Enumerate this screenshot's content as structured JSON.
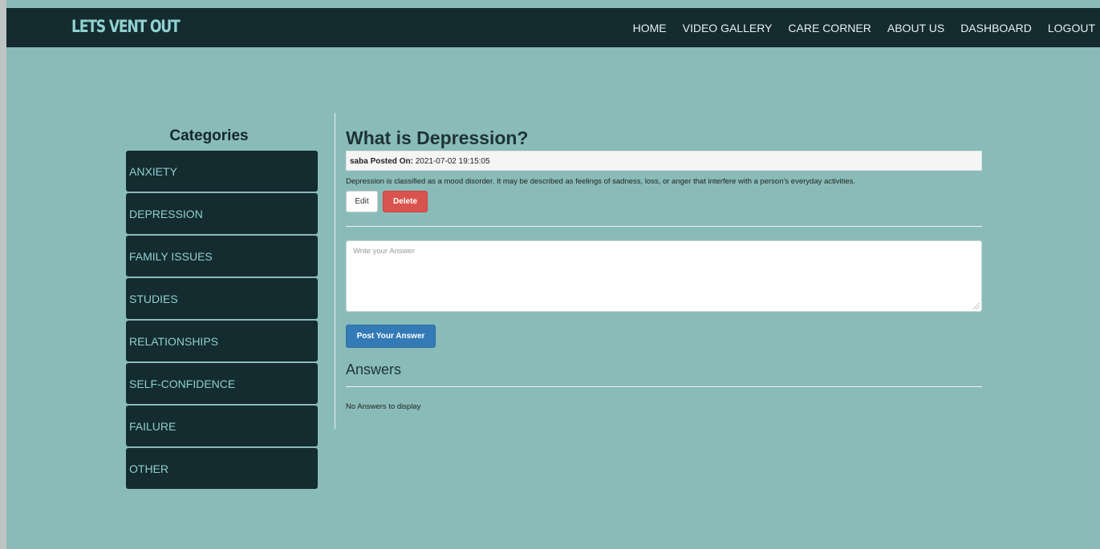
{
  "navbar": {
    "brand": "LETS VENT OUT",
    "links": [
      "HOME",
      "VIDEO GALLERY",
      "CARE CORNER",
      "ABOUT US",
      "DASHBOARD",
      "LOGOUT"
    ]
  },
  "sidebar": {
    "title": "Categories",
    "items": [
      "ANXIETY",
      "DEPRESSION",
      "FAMILY ISSUES",
      "STUDIES",
      "RELATIONSHIPS",
      "SELF-CONFIDENCE",
      "FAILURE",
      "OTHER"
    ]
  },
  "question": {
    "title": "What is Depression?",
    "author": "saba",
    "posted_label": "Posted On:",
    "posted_on": "2021-07-02 19:15:05",
    "body": "Depression is classified as a mood disorder. It may be described as feelings of sadness, loss, or anger that interfere with a person’s everyday activities.",
    "edit_label": "Edit",
    "delete_label": "Delete"
  },
  "answer_form": {
    "placeholder": "Write your Answer",
    "value": "",
    "submit_label": "Post Your Answer"
  },
  "answers": {
    "heading": "Answers",
    "empty_text": "No Answers to display"
  },
  "colors": {
    "background": "#89bcb9",
    "navbar": "#142b30",
    "sidebar_item": "#142b30",
    "delete": "#d9534f",
    "primary": "#337ab7"
  }
}
